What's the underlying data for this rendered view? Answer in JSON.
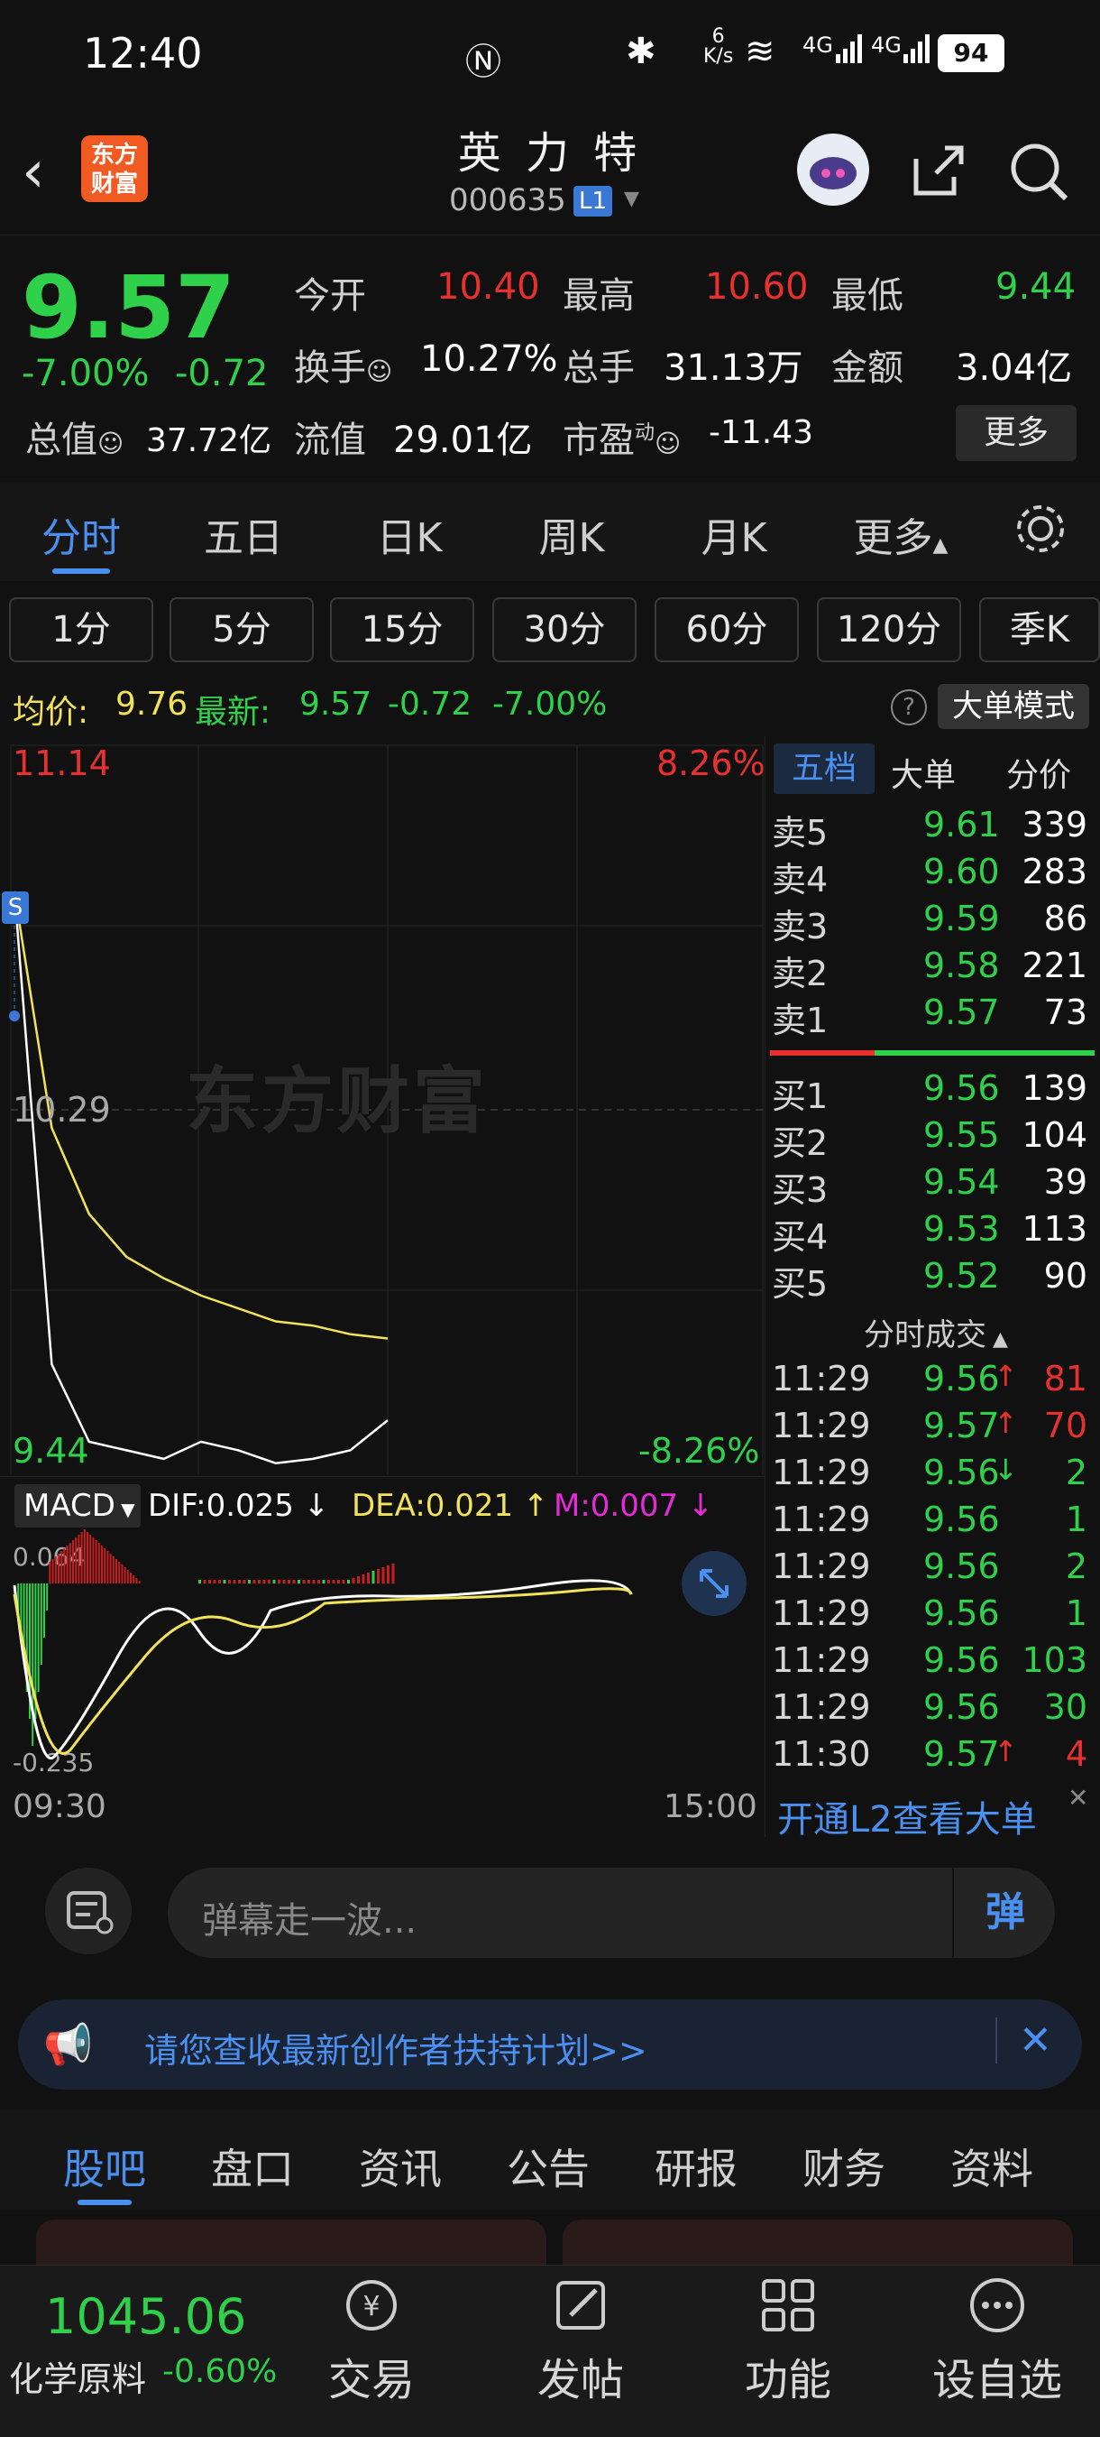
{
  "status_bar": {
    "time": "12:40",
    "net_speed_top": "6",
    "net_speed_unit": "K/s",
    "signal1": "4G",
    "signal2": "4G",
    "battery": "94"
  },
  "header": {
    "logo_line1": "东方",
    "logo_line2": "财富",
    "stock_name": "英 力 特",
    "stock_code": "000635",
    "level_badge": "L1"
  },
  "quote": {
    "price": "9.57",
    "change_pct": "-7.00%",
    "change": "-0.72",
    "open_label": "今开",
    "open": "10.40",
    "high_label": "最高",
    "high": "10.60",
    "low_label": "最低",
    "low": "9.44",
    "turnover_label": "换手",
    "turnover": "10.27%",
    "volume_label": "总手",
    "volume": "31.13万",
    "amount_label": "金额",
    "amount": "3.04亿",
    "mktcap_label": "总值",
    "mktcap": "37.72亿",
    "float_label": "流值",
    "float": "29.01亿",
    "pe_label": "市盈",
    "pe_sup": "动",
    "pe": "-11.43",
    "more_button": "更多"
  },
  "chart_tabs": [
    "分时",
    "五日",
    "日K",
    "周K",
    "月K",
    "更多"
  ],
  "interval_tabs": [
    "1分",
    "5分",
    "15分",
    "30分",
    "60分",
    "120分",
    "季K"
  ],
  "info_bar": {
    "avg_label": "均价:",
    "avg": "9.76",
    "latest_label": "最新:",
    "latest": "9.57",
    "chg": "-0.72",
    "chg_pct": "-7.00%",
    "big_order_mode": "大单模式"
  },
  "intraday": {
    "top_price": "11.14",
    "top_pct": "8.26%",
    "mid_price": "10.29",
    "bottom_price": "9.44",
    "bottom_pct": "-8.26%",
    "watermark": "东方财富",
    "s_marker": "S",
    "start_time": "09:30",
    "end_time": "15:00"
  },
  "macd": {
    "label": "MACD",
    "dif": "DIF:0.025",
    "dea": "DEA:0.021",
    "m": "M:0.007",
    "top": "0.064",
    "bottom": "-0.235"
  },
  "chart_data": {
    "type": "line",
    "x": [
      "09:30",
      "09:35",
      "09:40",
      "09:50",
      "10:00",
      "10:15",
      "10:30",
      "10:45",
      "11:00",
      "11:15",
      "11:30"
    ],
    "series": [
      {
        "values": [
          10.8,
          9.7,
          9.52,
          9.5,
          9.48,
          9.52,
          9.5,
          9.47,
          9.48,
          9.5,
          9.57
        ]
      },
      {
        "values": [
          10.8,
          10.25,
          10.05,
          9.95,
          9.9,
          9.86,
          9.83,
          9.8,
          9.79,
          9.77,
          9.76
        ]
      }
    ],
    "ylim": [
      9.44,
      11.14
    ]
  },
  "side_tabs": [
    "五档",
    "大单",
    "分价"
  ],
  "order_book": {
    "sells": [
      {
        "label": "卖5",
        "price": "9.61",
        "vol": "339"
      },
      {
        "label": "卖4",
        "price": "9.60",
        "vol": "283"
      },
      {
        "label": "卖3",
        "price": "9.59",
        "vol": "86"
      },
      {
        "label": "卖2",
        "price": "9.58",
        "vol": "221"
      },
      {
        "label": "卖1",
        "price": "9.57",
        "vol": "73"
      }
    ],
    "buys": [
      {
        "label": "买1",
        "price": "9.56",
        "vol": "139"
      },
      {
        "label": "买2",
        "price": "9.55",
        "vol": "104"
      },
      {
        "label": "买3",
        "price": "9.54",
        "vol": "39"
      },
      {
        "label": "买4",
        "price": "9.53",
        "vol": "113"
      },
      {
        "label": "买5",
        "price": "9.52",
        "vol": "90"
      }
    ]
  },
  "trades_header": "分时成交",
  "trades": [
    {
      "time": "11:29",
      "price": "9.56",
      "arrow": "↑",
      "vol": "81",
      "color": "red"
    },
    {
      "time": "11:29",
      "price": "9.57",
      "arrow": "↑",
      "vol": "70",
      "color": "red"
    },
    {
      "time": "11:29",
      "price": "9.56",
      "arrow": "↓",
      "vol": "2",
      "color": "green"
    },
    {
      "time": "11:29",
      "price": "9.56",
      "arrow": "",
      "vol": "1",
      "color": "green"
    },
    {
      "time": "11:29",
      "price": "9.56",
      "arrow": "",
      "vol": "2",
      "color": "green"
    },
    {
      "time": "11:29",
      "price": "9.56",
      "arrow": "",
      "vol": "1",
      "color": "green"
    },
    {
      "time": "11:29",
      "price": "9.56",
      "arrow": "",
      "vol": "103",
      "color": "green"
    },
    {
      "time": "11:29",
      "price": "9.56",
      "arrow": "",
      "vol": "30",
      "color": "green"
    },
    {
      "time": "11:30",
      "price": "9.57",
      "arrow": "↑",
      "vol": "4",
      "color": "red"
    }
  ],
  "l2_link": "开通L2查看大单",
  "danmaku": {
    "placeholder": "弹幕走一波...",
    "button": "弹"
  },
  "banner": "请您查收最新创作者扶持计划>>",
  "bottom_tabs": [
    "股吧",
    "盘口",
    "资讯",
    "公告",
    "研报",
    "财务",
    "资料"
  ],
  "index": {
    "value": "1045.06",
    "name": "化学原料",
    "pct": "-0.60%"
  },
  "nav": [
    "交易",
    "发帖",
    "功能",
    "设自选"
  ]
}
